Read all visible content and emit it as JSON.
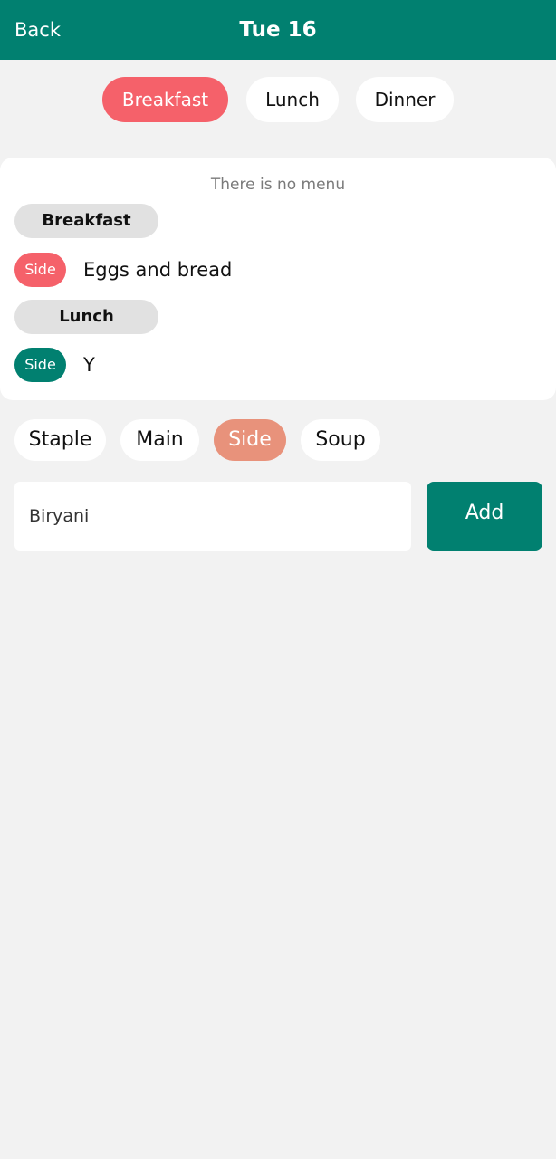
{
  "header": {
    "back_label": "Back",
    "title": "Tue 16"
  },
  "meal_tabs": [
    {
      "label": "Breakfast",
      "active": true
    },
    {
      "label": "Lunch",
      "active": false
    },
    {
      "label": "Dinner",
      "active": false
    }
  ],
  "menu": {
    "empty_message": "There is no menu",
    "sections": [
      {
        "label": "Breakfast",
        "items": [
          {
            "type": "Side",
            "name": "Eggs and bread"
          }
        ]
      },
      {
        "label": "Lunch",
        "items": [
          {
            "type": "Side",
            "name": "Y"
          }
        ]
      }
    ]
  },
  "dish_types": [
    {
      "label": "Staple",
      "active": false
    },
    {
      "label": "Main",
      "active": false
    },
    {
      "label": "Side",
      "active": true
    },
    {
      "label": "Soup",
      "active": false
    }
  ],
  "add_form": {
    "input_value": "Biryani",
    "add_label": "Add"
  },
  "colors": {
    "header": "#018070",
    "active_meal": "#f5616a",
    "active_type": "#e8927b",
    "breakfast_badge": "#f5616a",
    "lunch_badge": "#018070",
    "add_button": "#018070"
  }
}
